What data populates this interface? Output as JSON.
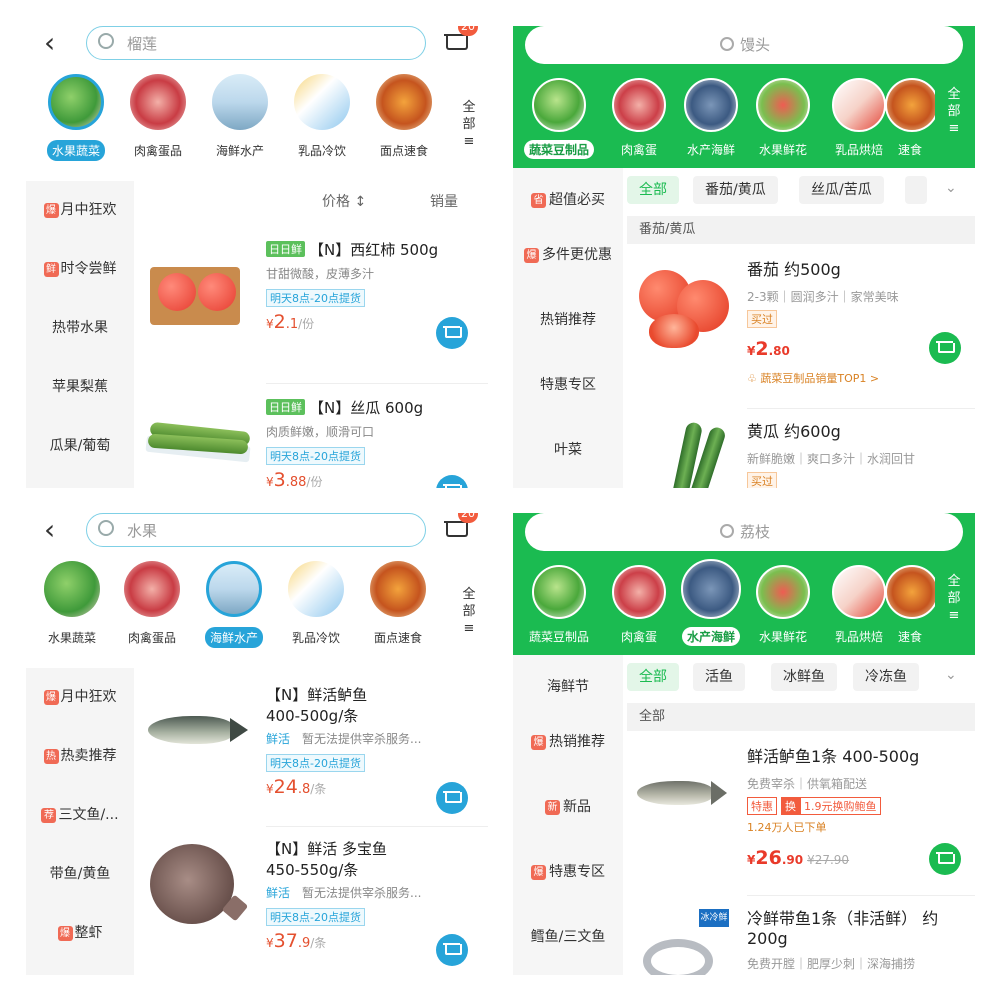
{
  "panel1": {
    "search_placeholder": "榴莲",
    "cart_badge": "20",
    "categories": [
      "水果蔬菜",
      "肉禽蛋品",
      "海鲜水产",
      "乳品冷饮",
      "面点速食"
    ],
    "all_label": "全部",
    "sidebar": [
      {
        "tag": "爆",
        "label": "月中狂欢"
      },
      {
        "tag": "鲜",
        "label": "时令尝鲜"
      },
      {
        "tag": "",
        "label": "热带水果"
      },
      {
        "tag": "",
        "label": "苹果梨蕉"
      },
      {
        "tag": "",
        "label": "瓜果/葡萄"
      }
    ],
    "sort": {
      "price": "价格",
      "sales": "销量"
    },
    "products": [
      {
        "badge": "日日鲜",
        "name": "【N】西红柿 500g",
        "desc": "甘甜微酸，皮薄多汁",
        "pickup": "明天8点-20点提货",
        "price_symbol": "¥",
        "price_int": "2",
        "price_dec": ".1",
        "unit": "/份"
      },
      {
        "badge": "日日鲜",
        "name": "【N】丝瓜 600g",
        "desc": "肉质鲜嫩，顺滑可口",
        "pickup": "明天8点-20点提货",
        "price_symbol": "¥",
        "price_int": "3",
        "price_dec": ".88",
        "unit": "/份"
      }
    ]
  },
  "panel2": {
    "search_placeholder": "馒头",
    "categories": [
      "蔬菜豆制品",
      "肉禽蛋",
      "水产海鲜",
      "水果鲜花",
      "乳品烘焙",
      "速食"
    ],
    "all_label": "全部",
    "sidebar": [
      {
        "tag": "省",
        "label": "超值必买"
      },
      {
        "tag": "爆",
        "label": "多件更优惠"
      },
      {
        "tag": "",
        "label": "热销推荐"
      },
      {
        "tag": "",
        "label": "特惠专区"
      },
      {
        "tag": "",
        "label": "叶菜"
      }
    ],
    "filters": [
      "全部",
      "番茄/黄瓜",
      "丝瓜/苦瓜"
    ],
    "section": "番茄/黄瓜",
    "products": [
      {
        "name": "番茄 约500g",
        "desc": "2-3颗｜圆润多汁｜家常美味",
        "tag": "买过",
        "price_symbol": "¥",
        "price_int": "2",
        "price_dec": ".80",
        "rank": "蔬菜豆制品销量TOP1 >"
      },
      {
        "name": "黄瓜 约600g",
        "desc": "新鲜脆嫩｜爽口多汁｜水润回甘",
        "tag": "买过"
      }
    ]
  },
  "panel3": {
    "search_placeholder": "水果",
    "cart_badge": "20",
    "categories": [
      "水果蔬菜",
      "肉禽蛋品",
      "海鲜水产",
      "乳品冷饮",
      "面点速食"
    ],
    "all_label": "全部",
    "sidebar": [
      {
        "tag": "爆",
        "label": "月中狂欢"
      },
      {
        "tag": "热",
        "label": "热卖推荐"
      },
      {
        "tag": "荐",
        "label": "三文鱼/..."
      },
      {
        "tag": "",
        "label": "带鱼/黄鱼"
      },
      {
        "tag": "爆",
        "label": "整虾"
      }
    ],
    "products": [
      {
        "name1": "【N】鲜活鲈鱼",
        "name2": "400-500g/条",
        "hl": "鲜活",
        "desc": "暂无法提供宰杀服务...",
        "pickup": "明天8点-20点提货",
        "price_symbol": "¥",
        "price_int": "24",
        "price_dec": ".8",
        "unit": "/条"
      },
      {
        "name1": "【N】鲜活 多宝鱼",
        "name2": "450-550g/条",
        "hl": "鲜活",
        "desc": "暂无法提供宰杀服务...",
        "pickup": "明天8点-20点提货",
        "price_symbol": "¥",
        "price_int": "37",
        "price_dec": ".9",
        "unit": "/条"
      }
    ]
  },
  "panel4": {
    "search_placeholder": "荔枝",
    "categories": [
      "蔬菜豆制品",
      "肉禽蛋",
      "水产海鲜",
      "水果鲜花",
      "乳品烘焙",
      "速食"
    ],
    "all_label": "全部",
    "sidebar": [
      {
        "tag": "",
        "label": "海鲜节"
      },
      {
        "tag": "爆",
        "label": "热销推荐"
      },
      {
        "tag": "新",
        "label": "新品"
      },
      {
        "tag": "爆",
        "label": "特惠专区"
      },
      {
        "tag": "",
        "label": "鳕鱼/三文鱼"
      }
    ],
    "filters": [
      "全部",
      "活鱼",
      "冰鲜鱼",
      "冷冻鱼"
    ],
    "section": "全部",
    "products": [
      {
        "name": "鲜活鲈鱼1条 400-500g",
        "desc": "免费宰杀｜供氧箱配送",
        "tags": [
          "特惠",
          "换",
          "1.9元换购鲍鱼"
        ],
        "sold": "1.24万人已下单",
        "price_symbol": "¥",
        "price_int": "26",
        "price_dec": ".90",
        "orig": "¥27.90"
      },
      {
        "name": "冷鲜带鱼1条（非活鲜） 约200g",
        "desc": "免费开膛｜肥厚少刺｜深海捕捞",
        "img_badge": "冰冷鲜"
      }
    ]
  }
}
